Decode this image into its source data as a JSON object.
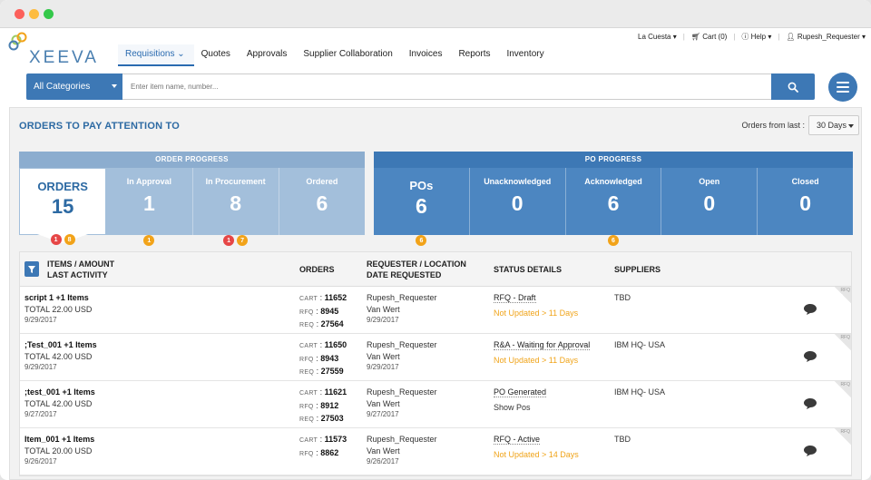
{
  "header": {
    "logo_text": "XEEVA",
    "nav": [
      {
        "label": "Requisitions ⌄",
        "active": true
      },
      {
        "label": "Quotes"
      },
      {
        "label": "Approvals"
      },
      {
        "label": "Supplier Collaboration"
      },
      {
        "label": "Invoices"
      },
      {
        "label": "Reports"
      },
      {
        "label": "Inventory"
      }
    ],
    "location": "La Cuesta",
    "cart": "Cart (0)",
    "help": "Help",
    "user": "Rupesh_Requester"
  },
  "search": {
    "category": "All Categories",
    "placeholder": "Enter item name, number..."
  },
  "section": {
    "title": "ORDERS TO PAY ATTENTION TO",
    "orders_from_label": "Orders from last :",
    "days_value": "30 Days"
  },
  "order_progress": {
    "title": "ORDER PROGRESS",
    "tiles": [
      {
        "label": "ORDERS",
        "value": "15",
        "badges": [
          {
            "color": "red",
            "value": "1"
          },
          {
            "color": "orange",
            "value": "8"
          }
        ]
      },
      {
        "label": "In Approval",
        "value": "1",
        "badges": [
          {
            "color": "orange",
            "value": "1"
          }
        ]
      },
      {
        "label": "In Procurement",
        "value": "8",
        "badges": [
          {
            "color": "red",
            "value": "1"
          },
          {
            "color": "orange",
            "value": "7"
          }
        ]
      },
      {
        "label": "Ordered",
        "value": "6",
        "badges": []
      }
    ]
  },
  "po_progress": {
    "title": "PO PROGRESS",
    "tiles": [
      {
        "label": "POs",
        "value": "6",
        "badges": [
          {
            "color": "orange",
            "value": "6"
          }
        ]
      },
      {
        "label": "Unacknowledged",
        "value": "0",
        "badges": []
      },
      {
        "label": "Acknowledged",
        "value": "6",
        "badges": [
          {
            "color": "orange",
            "value": "6"
          }
        ]
      },
      {
        "label": "Open",
        "value": "0",
        "badges": []
      },
      {
        "label": "Closed",
        "value": "0",
        "badges": []
      }
    ]
  },
  "table": {
    "headers": {
      "items": "ITEMS / AMOUNT",
      "items2": "LAST ACTIVITY",
      "orders": "ORDERS",
      "requester": "REQUESTER / LOCATION",
      "requester2": "DATE REQUESTED",
      "status": "STATUS DETAILS",
      "suppliers": "SUPPLIERS"
    },
    "labels": {
      "cart": "CART",
      "rfq": "RFQ",
      "req": "REQ",
      "corner": "RFQ"
    },
    "rows": [
      {
        "item": "script 1 +1 Items",
        "total": "TOTAL 22.00 USD",
        "date": "9/29/2017",
        "cart": "11652",
        "rfq": "8945",
        "req": "27564",
        "requester": "Rupesh_Requester",
        "location": "Van Wert",
        "requested": "9/29/2017",
        "status": "RFQ - Draft",
        "status_sub": "Not Updated > 11 Days",
        "supplier": "TBD"
      },
      {
        "item": ";Test_001 +1 Items",
        "total": "TOTAL 42.00 USD",
        "date": "9/29/2017",
        "cart": "11650",
        "rfq": "8943",
        "req": "27559",
        "requester": "Rupesh_Requester",
        "location": "Van Wert",
        "requested": "9/29/2017",
        "status": "R&A - Waiting for Approval",
        "status_sub": "Not Updated > 11 Days",
        "supplier": "IBM HQ- USA"
      },
      {
        "item": ";test_001 +1 Items",
        "total": "TOTAL 42.00 USD",
        "date": "9/27/2017",
        "cart": "11621",
        "rfq": "8912",
        "req": "27503",
        "requester": "Rupesh_Requester",
        "location": "Van Wert",
        "requested": "9/27/2017",
        "status": "PO Generated",
        "status_sub": "Show Pos",
        "supplier": "IBM HQ- USA"
      },
      {
        "item": "Item_001 +1 Items",
        "total": "TOTAL 20.00 USD",
        "date": "9/26/2017",
        "cart": "11573",
        "rfq": "8862",
        "req": "",
        "requester": "Rupesh_Requester",
        "location": "Van Wert",
        "requested": "9/26/2017",
        "status": "RFQ - Active",
        "status_sub": "Not Updated > 14 Days",
        "supplier": "TBD"
      }
    ]
  }
}
